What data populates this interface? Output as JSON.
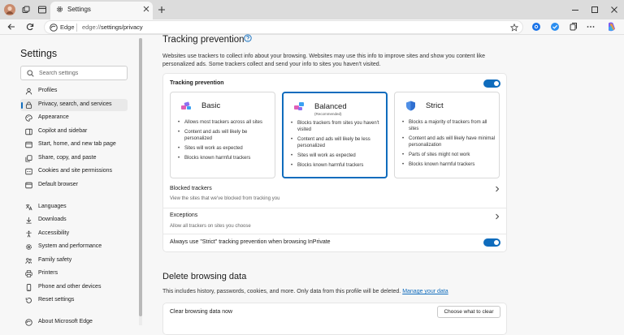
{
  "browser": {
    "tab_title": "Settings",
    "url_site": "Edge",
    "url_prefix": "edge://",
    "url_path": "settings/privacy",
    "colors": {
      "accent": "#0f6cbd",
      "tabbar": "#dcdcdc"
    }
  },
  "sidebar": {
    "title": "Settings",
    "search_placeholder": "Search settings",
    "items": [
      {
        "label": "Profiles",
        "icon": "profile-icon"
      },
      {
        "label": "Privacy, search, and services",
        "icon": "lock-icon",
        "active": true
      },
      {
        "label": "Appearance",
        "icon": "appearance-icon"
      },
      {
        "label": "Copilot and sidebar",
        "icon": "copilot-icon"
      },
      {
        "label": "Start, home, and new tab page",
        "icon": "home-icon"
      },
      {
        "label": "Share, copy, and paste",
        "icon": "share-icon"
      },
      {
        "label": "Cookies and site permissions",
        "icon": "cookies-icon"
      },
      {
        "label": "Default browser",
        "icon": "browser-icon"
      },
      {
        "label": "Languages",
        "icon": "languages-icon"
      },
      {
        "label": "Downloads",
        "icon": "download-icon"
      },
      {
        "label": "Accessibility",
        "icon": "accessibility-icon"
      },
      {
        "label": "System and performance",
        "icon": "system-icon"
      },
      {
        "label": "Family safety",
        "icon": "family-icon"
      },
      {
        "label": "Printers",
        "icon": "printer-icon"
      },
      {
        "label": "Phone and other devices",
        "icon": "phone-icon"
      },
      {
        "label": "Reset settings",
        "icon": "reset-icon"
      },
      {
        "label": "About Microsoft Edge",
        "icon": "edge-icon"
      }
    ]
  },
  "tracking": {
    "heading": "Tracking prevention",
    "description": "Websites use trackers to collect info about your browsing. Websites may use this info to improve sites and show you content like personalized ads. Some trackers collect and send your info to sites you haven't visited.",
    "toggle_label": "Tracking prevention",
    "toggle_on": true,
    "options": [
      {
        "title": "Basic",
        "recommended": "",
        "selected": false,
        "bullets": [
          "Allows most trackers across all sites",
          "Content and ads will likely be personalized",
          "Sites will work as expected",
          "Blocks known harmful trackers"
        ]
      },
      {
        "title": "Balanced",
        "recommended": "(Recommended)",
        "selected": true,
        "bullets": [
          "Blocks trackers from sites you haven't visited",
          "Content and ads will likely be less personalized",
          "Sites will work as expected",
          "Blocks known harmful trackers"
        ]
      },
      {
        "title": "Strict",
        "recommended": "",
        "selected": false,
        "bullets": [
          "Blocks a majority of trackers from all sites",
          "Content and ads will likely have minimal personalization",
          "Parts of sites might not work",
          "Blocks known harmful trackers"
        ]
      }
    ],
    "blocked_title": "Blocked trackers",
    "blocked_sub": "View the sites that we've blocked from tracking you",
    "exceptions_title": "Exceptions",
    "exceptions_sub": "Allow all trackers on sites you choose",
    "strict_inprivate_label": "Always use \"Strict\" tracking prevention when browsing InPrivate",
    "strict_inprivate_on": true
  },
  "delete": {
    "heading": "Delete browsing data",
    "description": "This includes history, passwords, cookies, and more. Only data from this profile will be deleted.",
    "manage_link": "Manage your data",
    "clear_now_label": "Clear browsing data now",
    "choose_button": "Choose what to clear"
  }
}
